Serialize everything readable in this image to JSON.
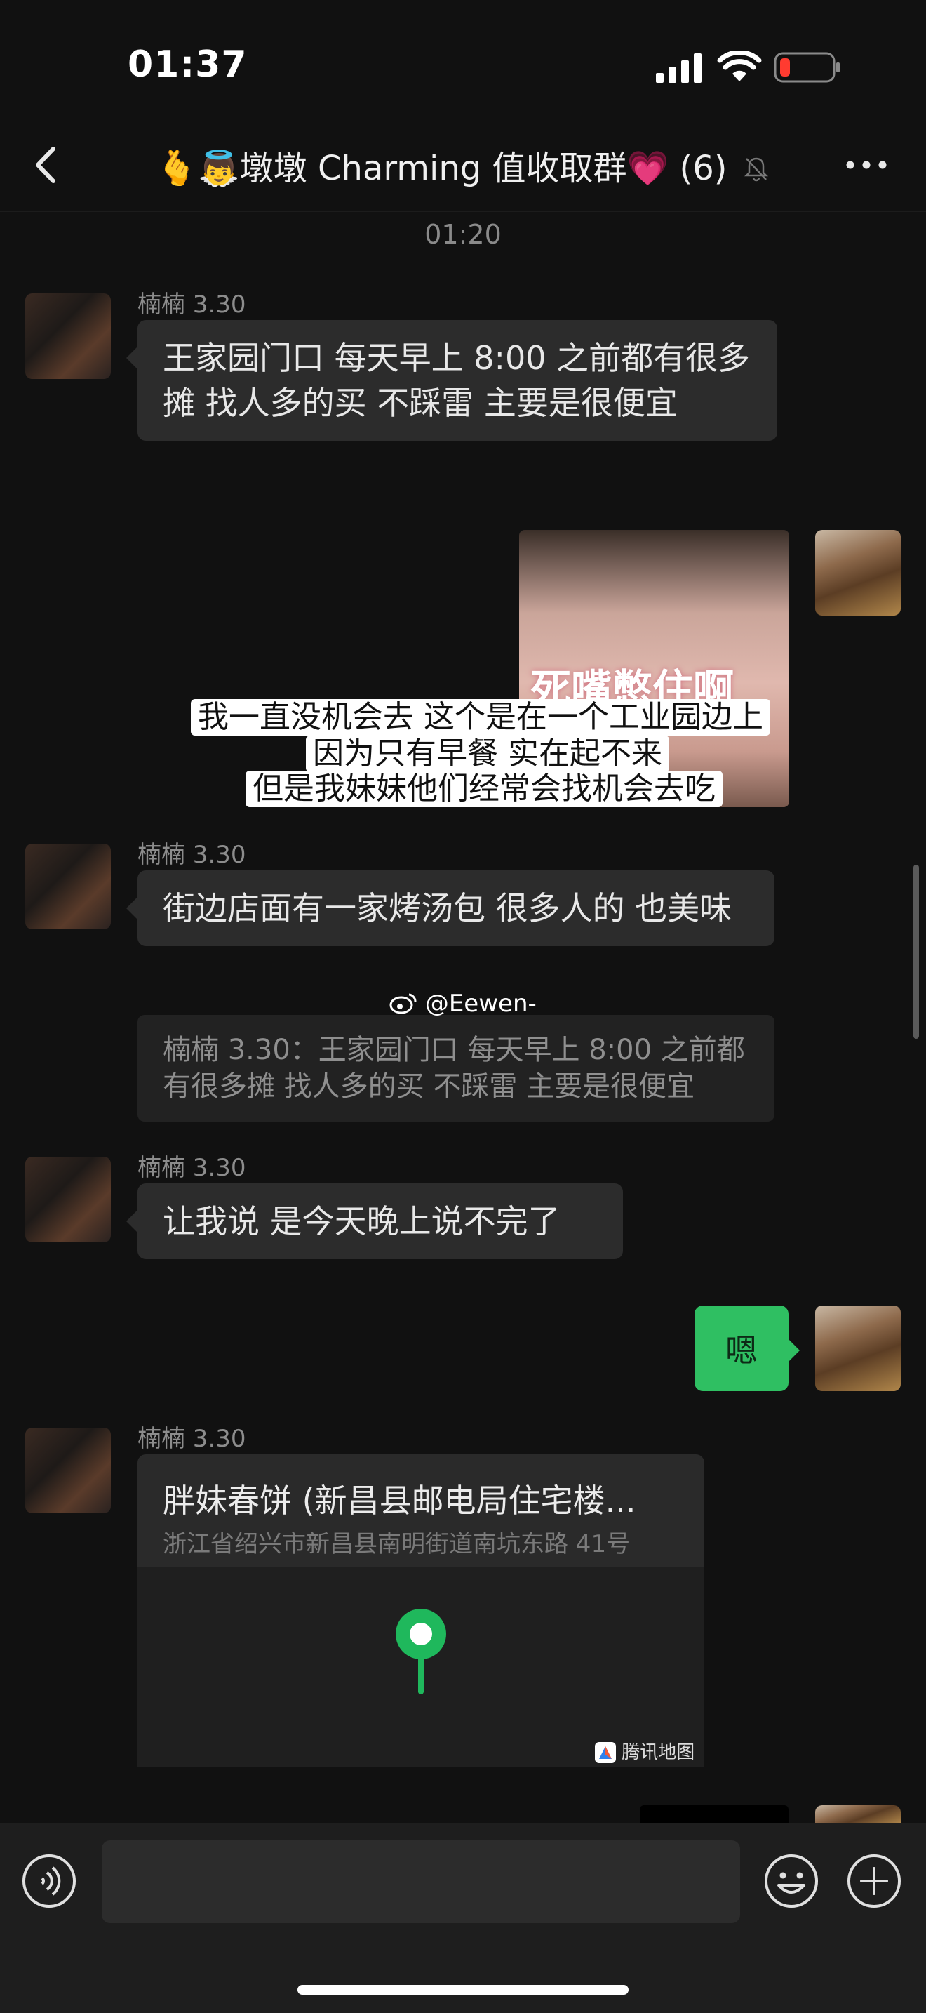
{
  "status_bar": {
    "time": "01:37"
  },
  "header": {
    "title": "🫰👼墩墩 Charming 值收取群💗 (6)",
    "back_icon": "chevron-left-icon",
    "mute_icon": "bell-slash-icon",
    "more_icon": "ellipsis-icon"
  },
  "chat": {
    "timestamp": "01:20",
    "sender_name": "楠楠 3.30",
    "msg1": "王家园门口 每天早上 8:00 之前都有很多摊 找人多的买 不踩雷 主要是很便宜",
    "image_sticker_text": "死嘴憋住啊",
    "image_caption": [
      "我一直没机会去 这个是在一个工业园边上",
      "因为只有早餐 实在起不来",
      "但是我妹妹他们经常会找机会去吃"
    ],
    "msg2": "街边店面有一家烤汤包 很多人的 也美味",
    "quote": "楠楠 3.30：王家园门口 每天早上 8:00 之前都有很多摊 找人多的买 不踩雷 主要是很便宜",
    "watermark": "@Eewen-",
    "msg3": "让我说 是今天晚上说不完了",
    "my_reply": "嗯",
    "location": {
      "name": "胖妹春饼 (新昌县邮电局住宅楼...",
      "address": "浙江省绍兴市新昌县南明街道南坑东路 41号",
      "map_brand": "腾讯地图"
    }
  },
  "input_bar": {
    "placeholder": "",
    "voice_icon": "voice-icon",
    "emoji_icon": "emoji-icon",
    "plus_icon": "plus-icon"
  },
  "colors": {
    "background": "#111111",
    "bubble": "#2c2c2c",
    "my_bubble": "#2fbf62",
    "pin": "#1fb85c"
  }
}
